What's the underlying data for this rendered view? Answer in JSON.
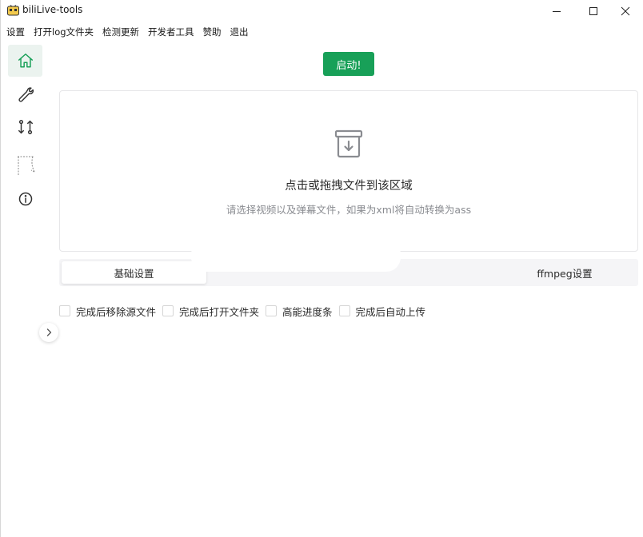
{
  "window": {
    "title": "biliLive-tools",
    "icon": "bili-app-icon"
  },
  "menu": [
    {
      "label": "设置"
    },
    {
      "label": "打开log文件夹"
    },
    {
      "label": "检测更新"
    },
    {
      "label": "开发者工具"
    },
    {
      "label": "赞助"
    },
    {
      "label": "退出"
    }
  ],
  "sidebar": {
    "items": [
      {
        "name": "home",
        "icon": "home-icon",
        "active": true
      },
      {
        "name": "tools",
        "icon": "wrench-icon"
      },
      {
        "name": "merge",
        "icon": "git-compare-icon"
      },
      {
        "name": "danmaku",
        "icon": "curtain-icon"
      },
      {
        "name": "about",
        "icon": "info-icon"
      }
    ]
  },
  "start_button": {
    "label": "启动!"
  },
  "upload": {
    "title": "点击或拖拽文件到该区域",
    "hint": "请选择视频以及弹幕文件，如果为xml将自动转换为ass"
  },
  "tabs": [
    {
      "label": "基础设置",
      "active": true
    },
    {
      "label": "ffmpeg设置",
      "active": false
    }
  ],
  "options": [
    {
      "label": "完成后移除源文件",
      "checked": false
    },
    {
      "label": "完成后打开文件夹",
      "checked": false
    },
    {
      "label": "高能进度条",
      "checked": false
    },
    {
      "label": "完成后自动上传",
      "checked": false
    }
  ],
  "colors": {
    "accent": "#18a058",
    "active_nav_bg": "#ebf3ef"
  }
}
